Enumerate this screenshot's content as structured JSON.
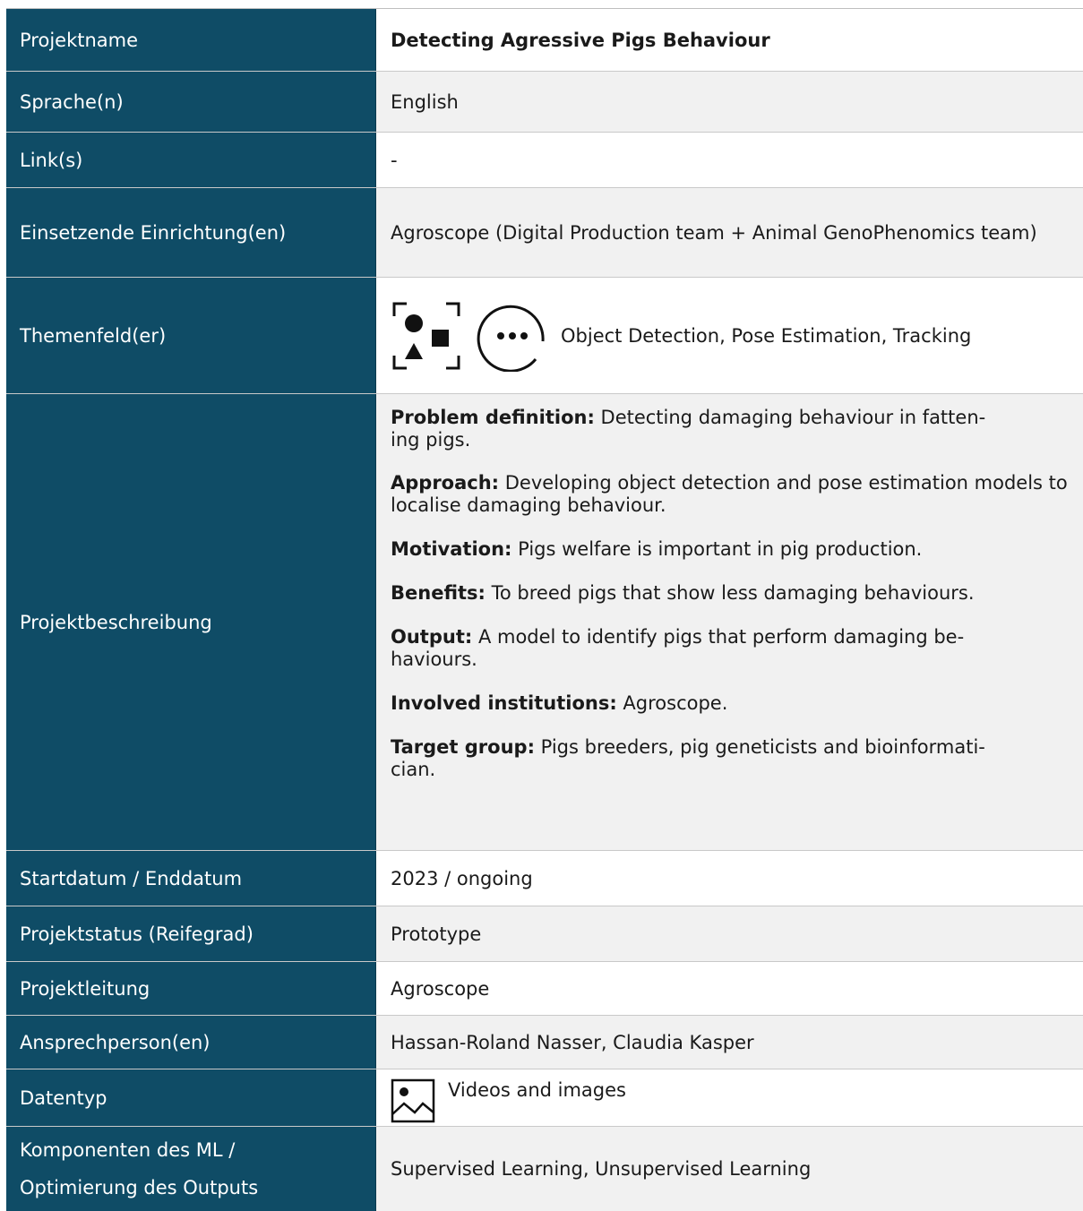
{
  "rows": {
    "project_name": {
      "label": "Projektname",
      "value": "Detecting Agressive Pigs Behaviour"
    },
    "languages": {
      "label": "Sprache(n)",
      "value": "English"
    },
    "links": {
      "label": "Link(s)",
      "value": "-"
    },
    "institution": {
      "label": "Einsetzende Einrichtung(en)",
      "value": "Agroscope (Digital Production team + Animal GenoPhenomics team)"
    },
    "topics": {
      "label": "Themenfeld(er)",
      "value": "Object Detection, Pose Estimation, Tracking",
      "icons": [
        "object-detection-icon",
        "more-options-icon"
      ]
    },
    "description": {
      "label": "Projektbeschreibung",
      "paragraphs": [
        {
          "heading": "Problem definition:",
          "text": " Detecting damaging behaviour in fatten-\ning pigs."
        },
        {
          "heading": "Approach:",
          "text": " Developing object detection and pose estimation models to localise damaging behaviour."
        },
        {
          "heading": "Motivation:",
          "text": " Pigs welfare is important in pig production."
        },
        {
          "heading": "Benefits:",
          "text": " To breed pigs that show less damaging behaviours."
        },
        {
          "heading": "Output:",
          "text": " A model to identify pigs that perform damaging be-\nhaviours."
        },
        {
          "heading": "Involved institutions:",
          "text": " Agroscope."
        },
        {
          "heading": "Target group:",
          "text": " Pigs breeders, pig geneticists and bioinformati-\ncian."
        }
      ]
    },
    "dates": {
      "label": "Startdatum / Enddatum",
      "value": "2023 / ongoing"
    },
    "status": {
      "label": "Projektstatus (Reifegrad)",
      "value": "Prototype"
    },
    "lead": {
      "label": "Projektleitung",
      "value": "Agroscope"
    },
    "contacts": {
      "label": "Ansprechperson(en)",
      "value": "Hassan-Roland Nasser, Claudia Kasper"
    },
    "datatype": {
      "label": "Datentyp",
      "value": "Videos and images",
      "icon": "image-icon"
    },
    "ml_components": {
      "label_line1": "Komponenten des ML /",
      "label_line2": "Optimierung des Outputs",
      "value": "Supervised Learning, Unsupervised Learning"
    }
  },
  "colors": {
    "label_background": "#0f4c66",
    "label_text": "#ffffff",
    "value_background_alt": "#f1f1f1",
    "value_text": "#1a1a1a"
  }
}
